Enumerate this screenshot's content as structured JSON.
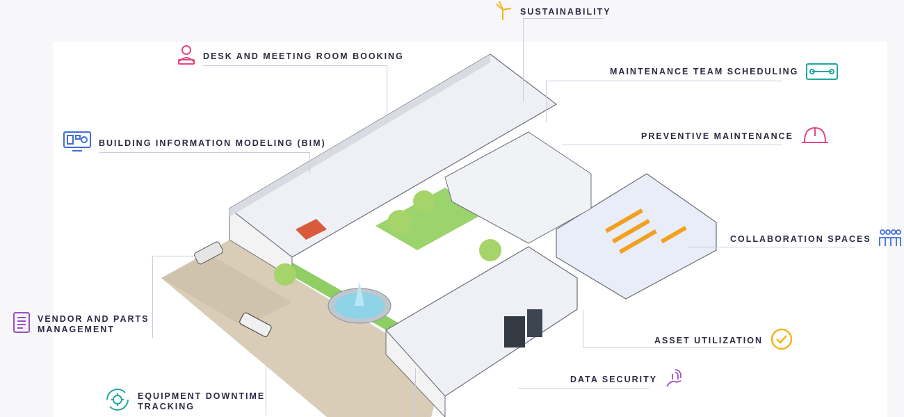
{
  "labels": {
    "sustainability": "SUSTAINABILITY",
    "desk_booking": "DESK AND MEETING ROOM BOOKING",
    "maintenance_scheduling": "MAINTENANCE TEAM SCHEDULING",
    "bim": "BUILDING INFORMATION MODELING (BIM)",
    "preventive": "PREVENTIVE MAINTENANCE",
    "collaboration": "COLLABORATION SPACES",
    "vendor_line1": "VENDOR AND PARTS",
    "vendor_line2": "MANAGEMENT",
    "asset": "ASSET UTILIZATION",
    "data_security": "DATA SECURITY",
    "downtime_line1": "EQUIPMENT DOWNTIME",
    "downtime_line2": "TRACKING"
  },
  "icons": {
    "sustainability": "wind-turbine-icon",
    "desk_booking": "user-laptop-icon",
    "maintenance_scheduling": "toolbox-wrench-icon",
    "bim": "monitor-blueprint-icon",
    "preventive": "hard-hat-icon",
    "collaboration": "group-people-icon",
    "vendor": "tablet-list-icon",
    "asset": "check-circle-icon",
    "data_security": "fingerprint-hand-icon",
    "downtime": "gear-cycle-icon"
  },
  "colors": {
    "label_text": "#2a2a44",
    "leader_line": "#c8cbe0",
    "pink": "#e8457a",
    "teal": "#1fa7a0",
    "blue": "#3f6fd8",
    "purple": "#9b4fc2",
    "orange": "#f2b51e",
    "grass": "#8fce63",
    "plaza": "#d9cdb8"
  }
}
